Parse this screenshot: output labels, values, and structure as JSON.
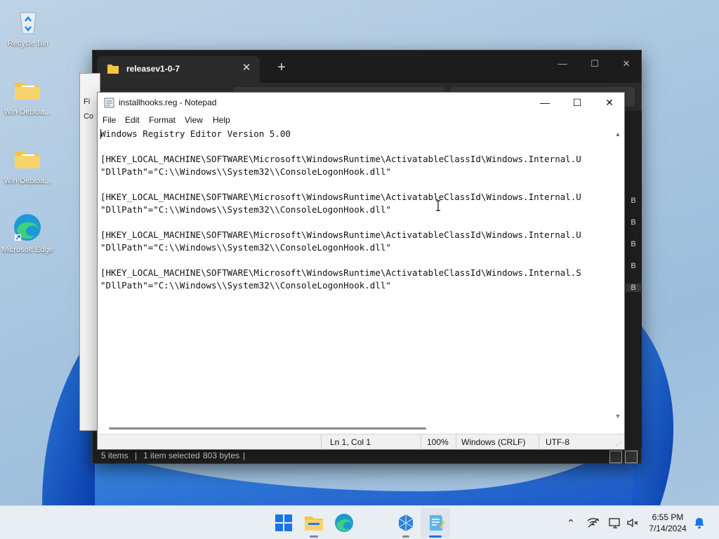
{
  "desktop": {
    "icons": [
      {
        "label": "Recycle Bin"
      },
      {
        "label": "Win-Debloa..."
      },
      {
        "label": "Win-Debloa..."
      },
      {
        "label": "Microsoft Edge"
      }
    ]
  },
  "explorer": {
    "tab_label": "releasev1-0-7",
    "tab_close": "✕",
    "new_tab": "+",
    "minimize": "—",
    "maximize": "☐",
    "close": "✕",
    "size_labels": [
      "B",
      "B",
      "B",
      "B",
      "B"
    ],
    "status": {
      "items": "5 items",
      "selected": "1 item selected",
      "size": "803 bytes"
    }
  },
  "behind_panel": {
    "text1": "Fi",
    "text2": "Co"
  },
  "notepad": {
    "title": "installhooks.reg - Notepad",
    "minimize": "—",
    "maximize": "☐",
    "close": "✕",
    "menu": [
      "File",
      "Edit",
      "Format",
      "View",
      "Help"
    ],
    "lines": [
      "Windows Registry Editor Version 5.00",
      "",
      "[HKEY_LOCAL_MACHINE\\SOFTWARE\\Microsoft\\WindowsRuntime\\ActivatableClassId\\Windows.Internal.U",
      "\"DllPath\"=\"C:\\\\Windows\\\\System32\\\\ConsoleLogonHook.dll\"",
      "",
      "[HKEY_LOCAL_MACHINE\\SOFTWARE\\Microsoft\\WindowsRuntime\\ActivatableClassId\\Windows.Internal.U",
      "\"DllPath\"=\"C:\\\\Windows\\\\System32\\\\ConsoleLogonHook.dll\"",
      "",
      "[HKEY_LOCAL_MACHINE\\SOFTWARE\\Microsoft\\WindowsRuntime\\ActivatableClassId\\Windows.Internal.U",
      "\"DllPath\"=\"C:\\\\Windows\\\\System32\\\\ConsoleLogonHook.dll\"",
      "",
      "[HKEY_LOCAL_MACHINE\\SOFTWARE\\Microsoft\\WindowsRuntime\\ActivatableClassId\\Windows.Internal.S",
      "\"DllPath\"=\"C:\\\\Windows\\\\System32\\\\ConsoleLogonHook.dll\""
    ],
    "status": {
      "position": "Ln 1, Col 1",
      "zoom": "100%",
      "line_ending": "Windows (CRLF)",
      "encoding": "UTF-8"
    }
  },
  "taskbar": {
    "apps": [
      "start-icon",
      "file-explorer-icon",
      "edge-icon",
      "sandbox-app-icon",
      "notepad-icon"
    ],
    "tray": [
      "chevron-up-icon",
      "network-off-icon",
      "display-icon",
      "volume-muted-icon"
    ],
    "clock": {
      "time": "6:55 PM",
      "date": "7/14/2024"
    },
    "notification_icon": "bell-icon"
  },
  "colors": {
    "accent": "#0067c0",
    "explorer_bg": "#202020",
    "wallpaper": "#a9c6e0"
  }
}
